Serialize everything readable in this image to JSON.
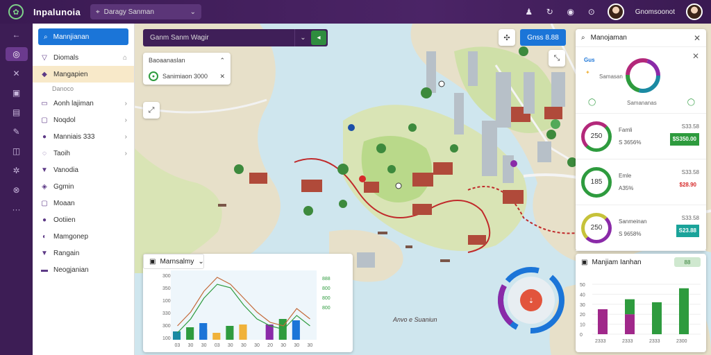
{
  "header": {
    "app_title": "Inpalunoia",
    "search_placeholder": "Daragy Sanman",
    "user_name": "Gnomsoonot"
  },
  "top_icons": [
    "bell-icon",
    "refresh-icon",
    "help-icon",
    "settings-icon"
  ],
  "rail": [
    {
      "name": "back-arrow-icon",
      "glyph": "←"
    },
    {
      "name": "layers-icon",
      "glyph": "◎"
    },
    {
      "name": "measure-icon",
      "glyph": "✕"
    },
    {
      "name": "image-icon",
      "glyph": "▣"
    },
    {
      "name": "document-icon",
      "glyph": "▤"
    },
    {
      "name": "draw-icon",
      "glyph": "✎"
    },
    {
      "name": "panel-icon",
      "glyph": "◫"
    },
    {
      "name": "globe-icon",
      "glyph": "✲"
    },
    {
      "name": "target-icon",
      "glyph": "⊗"
    },
    {
      "name": "more-icon",
      "glyph": "···"
    }
  ],
  "sidebar": {
    "search_label": "Mannjianan",
    "items": [
      {
        "label": "Diomals",
        "icon": "▽",
        "arrow": "⌂"
      },
      {
        "label": "Mangapien",
        "icon": "◆",
        "arrow": "",
        "highlight": true
      },
      {
        "label": "Aonh lajiman",
        "icon": "▭",
        "arrow": "›"
      },
      {
        "label": "Noqdol",
        "icon": "▢",
        "arrow": "›"
      },
      {
        "label": "Manniais 333",
        "icon": "●",
        "arrow": "›"
      },
      {
        "label": "Taoih",
        "icon": "◌",
        "arrow": "›"
      },
      {
        "label": "Vanodia",
        "icon": "▼",
        "arrow": ""
      },
      {
        "label": "Ggmin",
        "icon": "◈",
        "arrow": ""
      },
      {
        "label": "Moaan",
        "icon": "▢",
        "arrow": ""
      },
      {
        "label": "Ootiien",
        "icon": "●",
        "arrow": ""
      },
      {
        "label": "Mamgonep",
        "icon": "◐",
        "arrow": ""
      },
      {
        "label": "Rangain",
        "icon": "▼",
        "arrow": ""
      },
      {
        "label": "Neogjanian",
        "icon": "▬",
        "arrow": ""
      }
    ],
    "sub_label": "Danoco"
  },
  "map_bar": {
    "text": "Ganm Sanm Wagir"
  },
  "route_card": {
    "label": "Baoaanaslan",
    "value": "Sanimiaon 3000"
  },
  "blue_button": {
    "label": "Gnss 8.88"
  },
  "map_labels": [
    {
      "text": "Anvo e Suaniun"
    }
  ],
  "right_panel": {
    "title": "Manojaman",
    "overview_left_top": "Gus",
    "overview_left_mid": "Samasan",
    "overview_bottom": "Samananas",
    "stats": [
      {
        "ring_value": "250",
        "name": "Famli",
        "pct": "S 3656%",
        "right_top": "S33.58",
        "right_val": "$S350.00",
        "val_color": "#2e9b3e",
        "ring_color": "#2e9b3e",
        "ring_color2": "#b3287a"
      },
      {
        "ring_value": "185",
        "name": "Emle",
        "pct": "A35%",
        "right_top": "S33.58",
        "right_val": "$28.90",
        "val_color": "#d62a2a",
        "ring_color": "#2e9b3e",
        "ring_color2": "#2e9b3e"
      },
      {
        "ring_value": "250",
        "name": "Sanmeinan",
        "pct": "S 9658%",
        "right_top": "S33.58",
        "right_val": "S23.88",
        "val_color": "#1aa39a",
        "ring_color": "#8a2aa8",
        "ring_color2": "#c6c23a"
      }
    ]
  },
  "line_chart_card": {
    "title": "Marnsalmy"
  },
  "bar_chart_card": {
    "title": "Manjiam Ianhan",
    "toggle": "88"
  },
  "chart_data": [
    {
      "type": "bar",
      "title": "Marnsalmy",
      "ytick_labels": [
        "300",
        "350",
        "100",
        "330",
        "300",
        "100"
      ],
      "xtick_labels": [
        "03",
        "30",
        "30",
        "03",
        "30",
        "30",
        "30",
        "20",
        "30",
        "30",
        "30"
      ],
      "legend": [
        "888",
        "800",
        "800",
        "800"
      ],
      "categories": [
        "1",
        "2",
        "3",
        "4",
        "5",
        "6",
        "7",
        "8",
        "9",
        "10",
        "11"
      ],
      "series": [
        {
          "color": "#1b8aa3",
          "values": [
            12,
            0,
            15,
            0,
            0,
            0,
            0,
            0,
            0,
            0,
            0
          ]
        },
        {
          "color": "#2e9b3e",
          "values": [
            0,
            18,
            0,
            0,
            20,
            0,
            0,
            0,
            30,
            0,
            0
          ]
        },
        {
          "color": "#f0b23a",
          "values": [
            0,
            0,
            0,
            10,
            0,
            22,
            0,
            0,
            0,
            0,
            0
          ]
        },
        {
          "color": "#8a2aa8",
          "values": [
            0,
            0,
            0,
            0,
            0,
            0,
            0,
            22,
            0,
            0,
            0
          ]
        },
        {
          "color": "#1b75d8",
          "values": [
            0,
            0,
            24,
            0,
            0,
            0,
            0,
            0,
            0,
            28,
            0
          ]
        }
      ],
      "line": {
        "color": "#c46a3a",
        "values": [
          20,
          40,
          70,
          90,
          80,
          60,
          40,
          25,
          20,
          45,
          30
        ]
      },
      "line2": {
        "color": "#2e9b3e",
        "values": [
          10,
          30,
          60,
          80,
          75,
          50,
          30,
          20,
          15,
          35,
          20
        ]
      }
    },
    {
      "type": "bar",
      "title": "Manjiam Ianhan",
      "ytick_labels": [
        "50",
        "40",
        "30",
        "20",
        "10",
        "0"
      ],
      "categories": [
        "2333",
        "2333",
        "2333",
        "2300"
      ],
      "series": [
        {
          "name": "purple",
          "color": "#a0288a",
          "values": [
            25,
            20,
            0,
            0
          ]
        },
        {
          "name": "green",
          "color": "#2e9b3e",
          "values": [
            0,
            15,
            32,
            46
          ]
        }
      ]
    }
  ],
  "colors": {
    "topbar": "#4b2466",
    "rail": "#3d1d55",
    "accent_blue": "#1b75d8",
    "water": "#cfe6ee",
    "land": "#e7e0c9"
  }
}
